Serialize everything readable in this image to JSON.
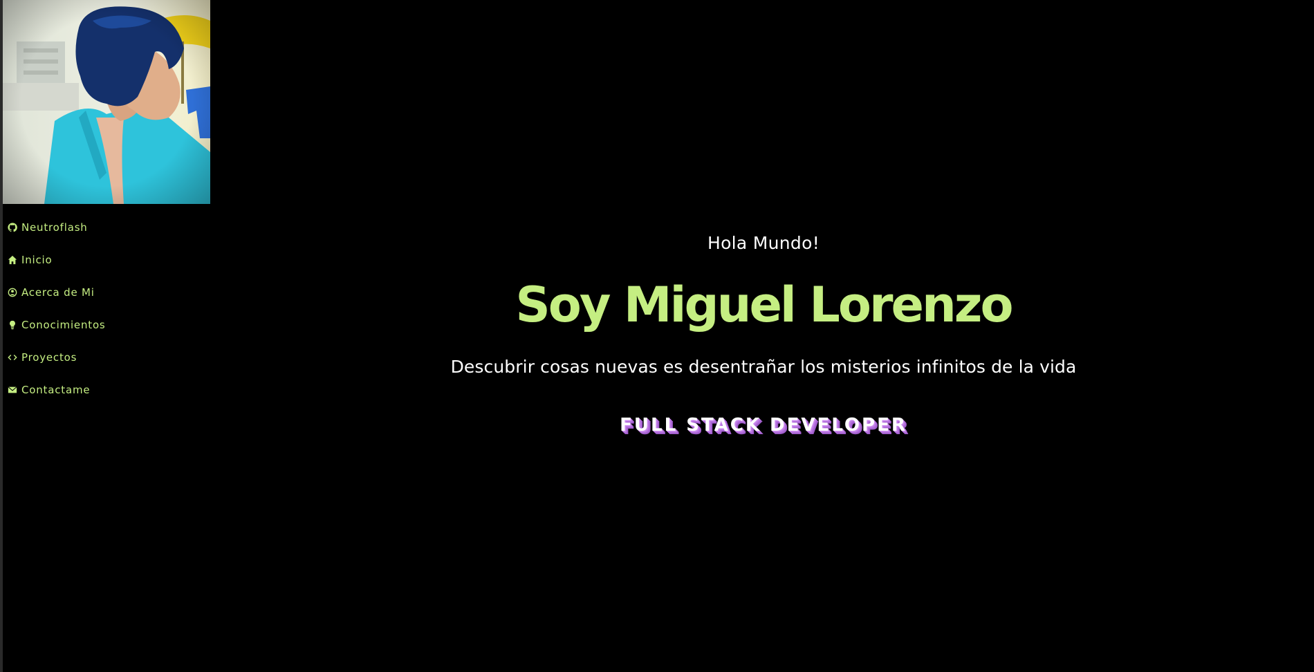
{
  "sidebar": {
    "avatar_alt": "profile-photo",
    "items": [
      {
        "label": "Neutroflash",
        "icon": "github-icon"
      },
      {
        "label": "Inicio",
        "icon": "home-icon"
      },
      {
        "label": "Acerca de Mi",
        "icon": "user-circle-icon"
      },
      {
        "label": "Conocimientos",
        "icon": "lightbulb-icon"
      },
      {
        "label": "Proyectos",
        "icon": "code-icon"
      },
      {
        "label": "Contactame",
        "icon": "envelope-icon"
      }
    ]
  },
  "hero": {
    "greeting": "Hola Mundo!",
    "name": "Soy Miguel Lorenzo",
    "tagline": "Descubrir cosas nuevas es desentrañar los misterios infinitos de la vida",
    "role": "FULL STACK DEVELOPER"
  },
  "colors": {
    "accent": "#c5ee82",
    "background": "#000000",
    "text": "#ffffff",
    "role_shadow": "#b36fdc"
  }
}
